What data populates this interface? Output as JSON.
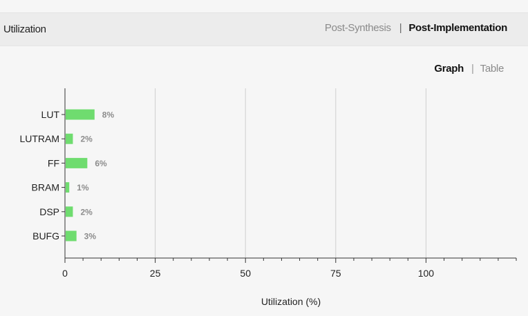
{
  "header": {
    "title": "Utilization",
    "tabs": [
      {
        "label": "Post-Synthesis",
        "active": false
      },
      {
        "label": "Post-Implementation",
        "active": true
      }
    ]
  },
  "view_toggle": {
    "graph_label": "Graph",
    "table_label": "Table",
    "active": "Graph"
  },
  "colors": {
    "bar": "#6fdc6f",
    "header_bg": "#ececec",
    "page_bg": "#f6f6f6"
  },
  "chart_data": {
    "type": "bar",
    "orientation": "horizontal",
    "categories": [
      "LUT",
      "LUTRAM",
      "FF",
      "BRAM",
      "DSP",
      "BUFG"
    ],
    "values": [
      8,
      2,
      6,
      1,
      2,
      3
    ],
    "value_labels": [
      "8%",
      "2%",
      "6%",
      "1%",
      "2%",
      "3%"
    ],
    "xlabel": "Utilization (%)",
    "xlim": [
      0,
      125
    ],
    "xticks": [
      0,
      25,
      50,
      75,
      100
    ],
    "tick_labels": [
      "0",
      "25",
      "50",
      "75",
      "100"
    ],
    "grid": true,
    "legend": "none"
  }
}
